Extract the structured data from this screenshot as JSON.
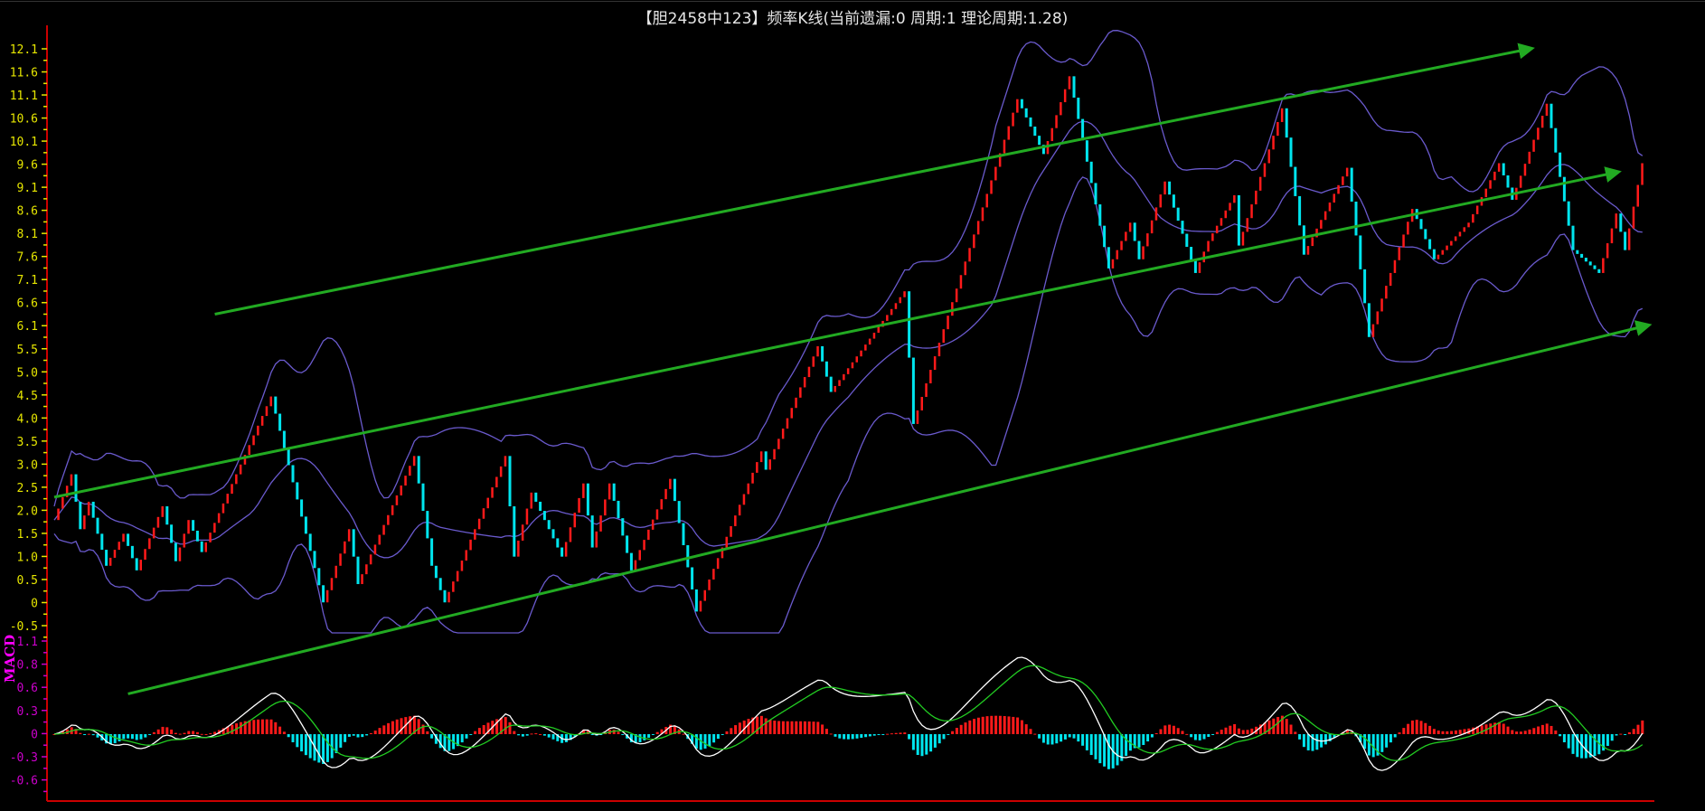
{
  "title": "【胆2458中123】频率K线(当前遗漏:0 周期:1 理论周期:1.28)",
  "colors": {
    "up": "#ff1a1a",
    "down": "#00e5ee",
    "axis": "#cc0000",
    "price_tick": "#e6e600",
    "macd_tick": "#cc00cc",
    "band": "#6a5acd",
    "trend": "#22aa22",
    "dif": "#ffffff",
    "dea": "#22cc22"
  },
  "chart_data": [
    {
      "type": "candlestick",
      "title": "【胆2458中123】频率K线(当前遗漏:0 周期:1 理论周期:1.28)",
      "ylim": [
        -0.5,
        12.1
      ],
      "y_tick_labels": [
        "12.1",
        "11.6",
        "11.1",
        "10.6",
        "10.1",
        "9.6",
        "9.1",
        "8.6",
        "8.1",
        "7.6",
        "7.1",
        "6.6",
        "6.1",
        "5.5",
        "5.0",
        "4.5",
        "4.0",
        "3.5",
        "3.0",
        "2.5",
        "2.0",
        "1.5",
        "1.0",
        "0.5",
        "0",
        "-0.5"
      ],
      "bars": 367,
      "price_waypoints": [
        [
          0,
          1.8
        ],
        [
          4,
          2.8
        ],
        [
          6,
          1.6
        ],
        [
          8,
          2.2
        ],
        [
          12,
          0.8
        ],
        [
          16,
          1.5
        ],
        [
          19,
          0.7
        ],
        [
          25,
          2.1
        ],
        [
          28,
          0.9
        ],
        [
          31,
          1.8
        ],
        [
          34,
          1.1
        ],
        [
          50,
          4.5
        ],
        [
          62,
          0.0
        ],
        [
          68,
          1.6
        ],
        [
          70,
          0.4
        ],
        [
          83,
          3.2
        ],
        [
          87,
          0.8
        ],
        [
          90,
          0.0
        ],
        [
          104,
          3.2
        ],
        [
          106,
          1.0
        ],
        [
          110,
          2.4
        ],
        [
          117,
          1.0
        ],
        [
          122,
          2.6
        ],
        [
          124,
          1.2
        ],
        [
          128,
          2.6
        ],
        [
          133,
          0.7
        ],
        [
          142,
          2.7
        ],
        [
          148,
          -0.2
        ],
        [
          163,
          3.3
        ],
        [
          164,
          2.9
        ],
        [
          176,
          5.6
        ],
        [
          179,
          4.6
        ],
        [
          196,
          6.8
        ],
        [
          198,
          3.9
        ],
        [
          222,
          11.0
        ],
        [
          228,
          9.8
        ],
        [
          234,
          11.5
        ],
        [
          243,
          7.3
        ],
        [
          248,
          8.3
        ],
        [
          250,
          7.5
        ],
        [
          256,
          9.2
        ],
        [
          263,
          7.2
        ],
        [
          266,
          7.9
        ],
        [
          272,
          8.9
        ],
        [
          273,
          7.8
        ],
        [
          283,
          10.8
        ],
        [
          288,
          7.6
        ],
        [
          298,
          9.5
        ],
        [
          303,
          5.8
        ],
        [
          313,
          8.6
        ],
        [
          318,
          7.5
        ],
        [
          326,
          8.3
        ],
        [
          333,
          9.6
        ],
        [
          336,
          8.8
        ],
        [
          344,
          10.9
        ],
        [
          350,
          7.7
        ],
        [
          356,
          7.2
        ],
        [
          360,
          8.5
        ],
        [
          362,
          7.7
        ],
        [
          366,
          9.6
        ]
      ],
      "bollinger": {
        "period": 20,
        "k": 2
      },
      "trend_lines": [
        {
          "name": "upper-channel",
          "from": [
            37,
            6.3
          ],
          "to": [
            340,
            12.1
          ]
        },
        {
          "name": "middle-channel",
          "from": [
            0,
            2.3
          ],
          "to": [
            360,
            9.4
          ]
        },
        {
          "name": "lower-channel",
          "from": [
            17,
            -2.0
          ],
          "to": [
            367,
            6.05
          ]
        }
      ]
    },
    {
      "type": "macd",
      "label": "MACD",
      "ylim": [
        -0.75,
        1.1
      ],
      "y_tick_labels": [
        "1.1",
        "0.8",
        "0.6",
        "0.3",
        "0",
        "-0.3",
        "-0.6"
      ],
      "params": {
        "fast": 12,
        "slow": 26,
        "signal": 9
      }
    }
  ]
}
